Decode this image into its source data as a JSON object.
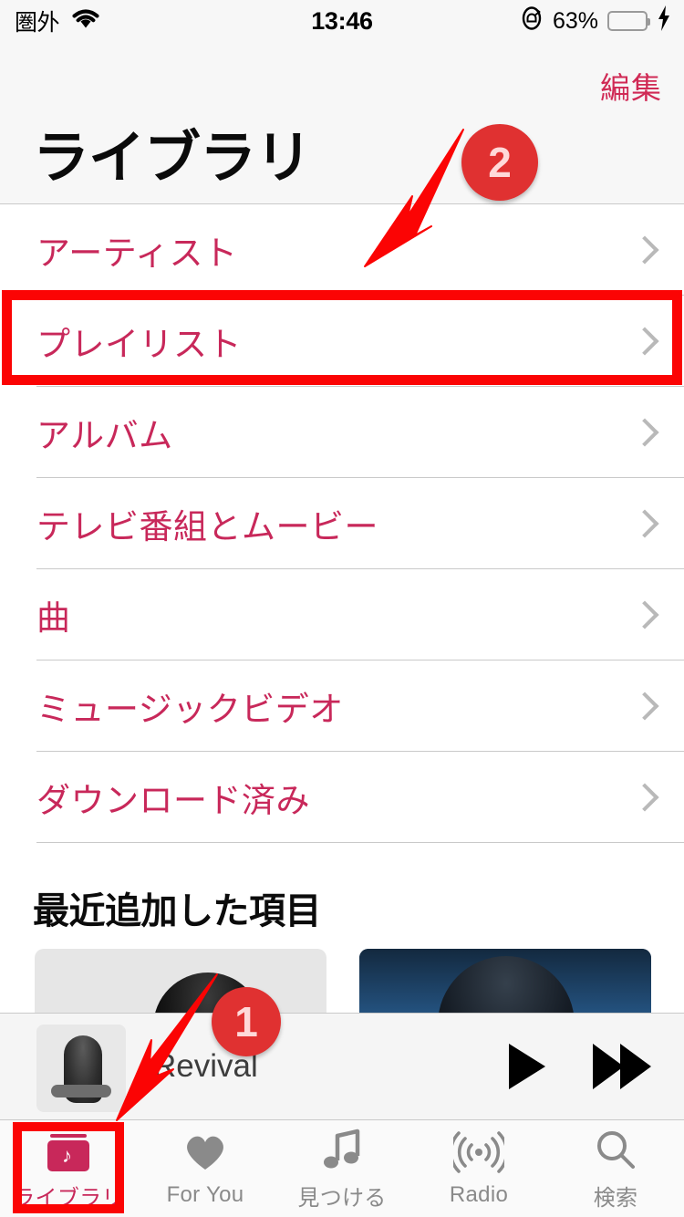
{
  "status_bar": {
    "carrier": "圏外",
    "wifi_icon": "wifi-icon",
    "time": "13:46",
    "rotation_lock_icon": "rotation-lock-icon",
    "battery_percent": "63%",
    "battery_level": 63,
    "charging_icon": "lightning-bolt-icon",
    "battery_color": "#4cd964"
  },
  "nav": {
    "edit_label": "編集",
    "title": "ライブラリ"
  },
  "menu": {
    "items": [
      {
        "label": "アーティスト",
        "name": "artists"
      },
      {
        "label": "プレイリスト",
        "name": "playlists"
      },
      {
        "label": "アルバム",
        "name": "albums"
      },
      {
        "label": "テレビ番組とムービー",
        "name": "tv-shows-and-movies"
      },
      {
        "label": "曲",
        "name": "songs"
      },
      {
        "label": "ミュージックビデオ",
        "name": "music-videos"
      },
      {
        "label": "ダウンロード済み",
        "name": "downloaded"
      }
    ],
    "chevron_icon": "chevron-right-icon",
    "accent_color": "#c8285a"
  },
  "recently_added": {
    "header": "最近追加した項目"
  },
  "mini_player": {
    "track_title": "Revival",
    "artwork_icon": "album-artwork",
    "play_icon": "play-icon",
    "forward_icon": "fast-forward-icon"
  },
  "tab_bar": {
    "tabs": [
      {
        "label": "ライブラリ",
        "icon": "library-icon",
        "active": true
      },
      {
        "label": "For You",
        "icon": "heart-icon",
        "active": false
      },
      {
        "label": "見つける",
        "icon": "music-note-icon",
        "active": false
      },
      {
        "label": "Radio",
        "icon": "radio-waves-icon",
        "active": false
      },
      {
        "label": "検索",
        "icon": "search-icon",
        "active": false
      }
    ]
  },
  "annotations": {
    "badge_1": "1",
    "badge_2": "2",
    "highlight_color": "#fb0404",
    "badge_color": "#e03131",
    "arrow_1_target": "ライブラリ",
    "arrow_2_target": "プレイリスト"
  }
}
